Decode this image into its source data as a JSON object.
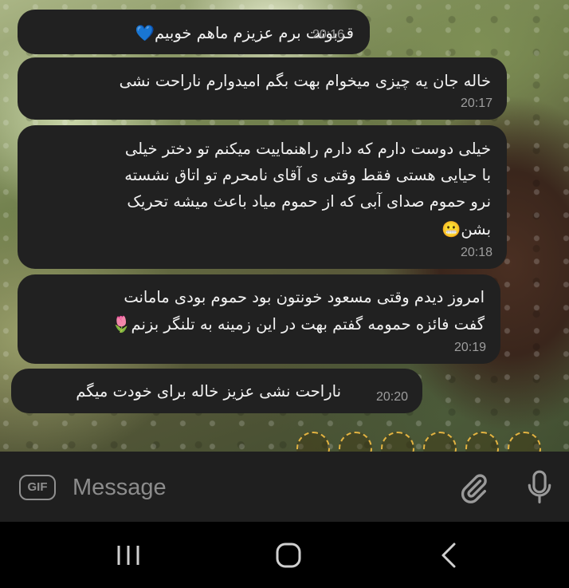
{
  "messages": [
    {
      "text_lines": [
        "قربونت برم عزیزم ماهم خوبیم💙"
      ],
      "time": "20:16"
    },
    {
      "text_lines": [
        "خاله جان یه چیزی میخوام بهت بگم امیدوارم ناراحت نشی"
      ],
      "time": "20:17"
    },
    {
      "text_lines": [
        "خیلی دوست دارم که دارم راهنماییت میکنم تو دختر خیلی",
        "با حیایی هستی فقط وقتی ی آقای نامحرم تو اتاق نشسته",
        "نرو حموم صدای آبی که از حموم میاد باعث میشه تحریک",
        "بشن😬"
      ],
      "time": "20:18"
    },
    {
      "text_lines": [
        "امروز دیدم وقتی مسعود خونتون بود حموم بودی مامانت",
        "گفت فائزه حمومه گفتم بهت در این زمینه به تلنگر بزنم🌷"
      ],
      "time": "20:19"
    },
    {
      "text_lines": [
        "ناراحت نشی عزیز خاله برای خودت میگم"
      ],
      "time": "20:20"
    }
  ],
  "input": {
    "placeholder": "Message",
    "value": "",
    "gif_label": "GIF"
  },
  "icons": {
    "gif": "gif-icon",
    "attach": "paperclip-icon",
    "mic": "microphone-icon",
    "nav_recents": "recents-icon",
    "nav_home": "home-icon",
    "nav_back": "back-icon"
  },
  "colors": {
    "bubble": "#212121",
    "input_bar": "#1f1f1f",
    "time_text": "#9e9e9e",
    "reaction_ring": "#e3b341"
  }
}
